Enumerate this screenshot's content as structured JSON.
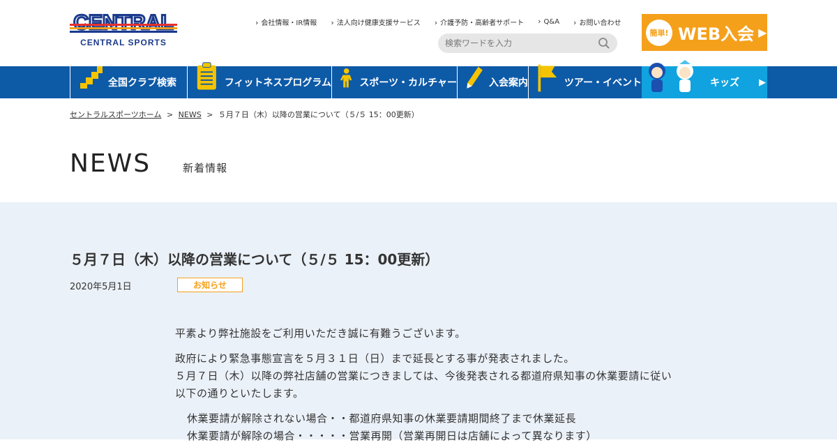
{
  "header": {
    "logo_text_top": "CENTRAL",
    "logo_text_bottom": "CENTRAL SPORTS",
    "util_links": [
      "会社情報・IR情報",
      "法人向け健康支援サービス",
      "介護予防・高齢者サポート",
      "Q&A",
      "お問い合わせ"
    ],
    "search_placeholder": "検索ワードを入力",
    "web_badge": "簡単!",
    "web_label": "WEB入会"
  },
  "nav": {
    "items": [
      {
        "label": "全国クラブ検索",
        "icon": "japan-map-icon"
      },
      {
        "label": "フィットネスプログラム",
        "icon": "clipboard-icon"
      },
      {
        "label": "スポーツ・カルチャー",
        "icon": "runner-icon"
      },
      {
        "label": "入会案内",
        "icon": "pencil-icon"
      },
      {
        "label": "ツアー・イベント",
        "icon": "flag-icon"
      }
    ],
    "kids_label": "キッズ"
  },
  "breadcrumb": {
    "home": "セントラルスポーツホーム",
    "news": "NEWS",
    "current": "５月７日（木）以降の営業について（５/５ 15：00更新）",
    "separator": ">"
  },
  "page": {
    "title": "NEWS",
    "subtitle": "新着情報"
  },
  "article": {
    "title": "５月７日（木）以降の営業について（５/５ 15：00更新）",
    "date": "2020年5月1日",
    "tag": "お知らせ",
    "paragraphs": [
      "平素より弊社施設をご利用いただき誠に有難うございます。",
      "政府により緊急事態宣言を５月３１日（日）まで延長とする事が発表されました。",
      "５月７日（木）以降の弊社店舗の営業につきましては、今後発表される都道府県知事の休業要請に従い以下の通りといたします。"
    ],
    "list": [
      "休業要請が解除されない場合・・都道府県知事の休業要請期間終了まで休業延長",
      "休業要請が解除の場合・・・・・営業再開（営業再開日は店舗によって異なります）"
    ]
  },
  "colors": {
    "nav_blue": "#0d5aa7",
    "kids_blue": "#10a3df",
    "accent_orange": "#f5a01b",
    "content_bg": "#ebf1f8"
  }
}
